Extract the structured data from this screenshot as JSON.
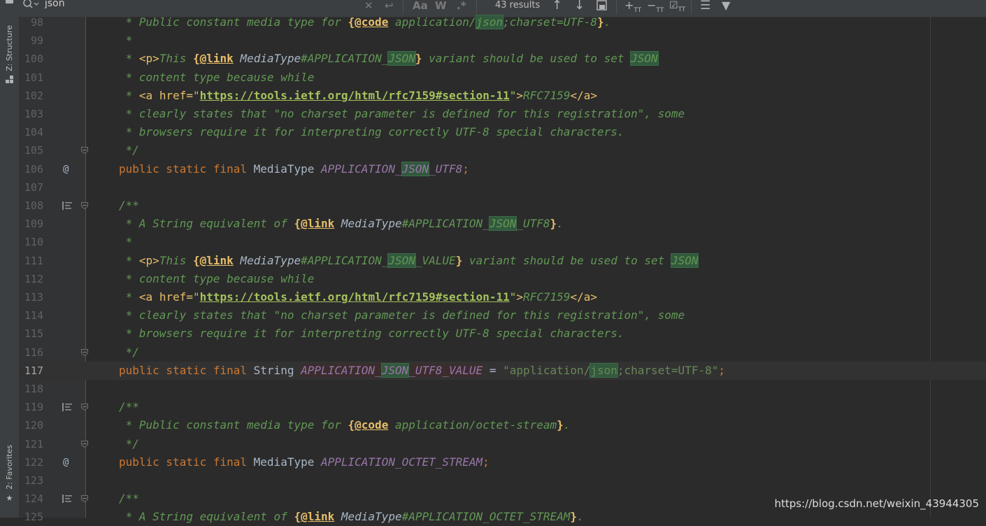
{
  "toolstrip": {
    "structure_label": "Z: Structure",
    "favorites_label": "2: Favorites"
  },
  "find": {
    "query": "json",
    "results": "43 results",
    "match_case_label": "Aa",
    "words_label": "W",
    "regex_label": ".*"
  },
  "editor": {
    "current_line": 117,
    "lines": [
      {
        "n": 98,
        "gutter": "",
        "fold": false
      },
      {
        "n": 99,
        "gutter": "",
        "fold": false
      },
      {
        "n": 100,
        "gutter": "",
        "fold": false
      },
      {
        "n": 101,
        "gutter": "",
        "fold": false
      },
      {
        "n": 102,
        "gutter": "",
        "fold": false
      },
      {
        "n": 103,
        "gutter": "",
        "fold": false
      },
      {
        "n": 104,
        "gutter": "",
        "fold": false
      },
      {
        "n": 105,
        "gutter": "",
        "fold": true
      },
      {
        "n": 106,
        "gutter": "@",
        "fold": false
      },
      {
        "n": 107,
        "gutter": "",
        "fold": false
      },
      {
        "n": 108,
        "gutter": "doc",
        "fold": true
      },
      {
        "n": 109,
        "gutter": "",
        "fold": false
      },
      {
        "n": 110,
        "gutter": "",
        "fold": false
      },
      {
        "n": 111,
        "gutter": "",
        "fold": false
      },
      {
        "n": 112,
        "gutter": "",
        "fold": false
      },
      {
        "n": 113,
        "gutter": "",
        "fold": false
      },
      {
        "n": 114,
        "gutter": "",
        "fold": false
      },
      {
        "n": 115,
        "gutter": "",
        "fold": false
      },
      {
        "n": 116,
        "gutter": "",
        "fold": true
      },
      {
        "n": 117,
        "gutter": "",
        "fold": false
      },
      {
        "n": 118,
        "gutter": "",
        "fold": false
      },
      {
        "n": 119,
        "gutter": "doc",
        "fold": true
      },
      {
        "n": 120,
        "gutter": "",
        "fold": false
      },
      {
        "n": 121,
        "gutter": "",
        "fold": true
      },
      {
        "n": 122,
        "gutter": "@",
        "fold": false
      },
      {
        "n": 123,
        "gutter": "",
        "fold": false
      },
      {
        "n": 124,
        "gutter": "doc",
        "fold": true
      },
      {
        "n": 125,
        "gutter": "",
        "fold": false
      }
    ]
  },
  "code": {
    "l98": [
      [
        "c",
        " * Public constant media type for "
      ],
      [
        "tg",
        "{"
      ],
      [
        "tg lk",
        "@code"
      ],
      [
        "c",
        " application/"
      ],
      [
        "c hl",
        "json"
      ],
      [
        "c",
        ";charset=UTF-8"
      ],
      [
        "tg",
        "}"
      ],
      [
        "c",
        "."
      ]
    ],
    "l99": [
      [
        "c",
        " *"
      ]
    ],
    "l100": [
      [
        "c",
        " * "
      ],
      [
        "ht",
        "<p>"
      ],
      [
        "c",
        "This "
      ],
      [
        "tg",
        "{"
      ],
      [
        "tg lk",
        "@link"
      ],
      [
        "rf",
        " MediaType"
      ],
      [
        "c",
        "#APPLICATION_"
      ],
      [
        "c hl",
        "JSON"
      ],
      [
        "tg",
        "}"
      ],
      [
        "c",
        " variant should be used to set "
      ],
      [
        "c hl",
        "JSON"
      ]
    ],
    "l101": [
      [
        "c",
        " * content type because while"
      ]
    ],
    "l102": [
      [
        "c",
        " * "
      ],
      [
        "ht",
        "<a "
      ],
      [
        "ht",
        "href="
      ],
      [
        "hv",
        "\""
      ],
      [
        "hv lk",
        "https://tools.ietf.org/html/rfc7159#section-11"
      ],
      [
        "hv",
        "\""
      ],
      [
        "ht",
        ">"
      ],
      [
        "c",
        "RFC7159"
      ],
      [
        "ht",
        "</a>"
      ]
    ],
    "l103": [
      [
        "c",
        " * clearly states that \"no charset parameter is defined for this registration\", some"
      ]
    ],
    "l104": [
      [
        "c",
        " * browsers require it for interpreting correctly UTF-8 special characters."
      ]
    ],
    "l105": [
      [
        "c",
        " */"
      ]
    ],
    "l106": [
      [
        "kw",
        "public static final "
      ],
      [
        "ty",
        "MediaType "
      ],
      [
        "fd",
        "APPLICATION_"
      ],
      [
        "fd hl",
        "JSON"
      ],
      [
        "fd",
        "_UTF8"
      ],
      [
        "kw",
        ";"
      ]
    ],
    "l107": [],
    "l108": [
      [
        "c",
        "/**"
      ]
    ],
    "l109": [
      [
        "c",
        " * A String equivalent of "
      ],
      [
        "tg",
        "{"
      ],
      [
        "tg lk",
        "@link"
      ],
      [
        "rf",
        " MediaType"
      ],
      [
        "c",
        "#APPLICATION_"
      ],
      [
        "c hl",
        "JSON"
      ],
      [
        "c",
        "_UTF8"
      ],
      [
        "tg",
        "}"
      ],
      [
        "c",
        "."
      ]
    ],
    "l110": [
      [
        "c",
        " *"
      ]
    ],
    "l111": [
      [
        "c",
        " * "
      ],
      [
        "ht",
        "<p>"
      ],
      [
        "c",
        "This "
      ],
      [
        "tg",
        "{"
      ],
      [
        "tg lk",
        "@link"
      ],
      [
        "rf",
        " MediaType"
      ],
      [
        "c",
        "#APPLICATION_"
      ],
      [
        "c hl",
        "JSON"
      ],
      [
        "c",
        "_VALUE"
      ],
      [
        "tg",
        "}"
      ],
      [
        "c",
        " variant should be used to set "
      ],
      [
        "c hl",
        "JSON"
      ]
    ],
    "l112": [
      [
        "c",
        " * content type because while"
      ]
    ],
    "l113": [
      [
        "c",
        " * "
      ],
      [
        "ht",
        "<a "
      ],
      [
        "ht",
        "href="
      ],
      [
        "hv",
        "\""
      ],
      [
        "hv lk",
        "https://tools.ietf.org/html/rfc7159#section-11"
      ],
      [
        "hv",
        "\""
      ],
      [
        "ht",
        ">"
      ],
      [
        "c",
        "RFC7159"
      ],
      [
        "ht",
        "</a>"
      ]
    ],
    "l114": [
      [
        "c",
        " * clearly states that \"no charset parameter is defined for this registration\", some"
      ]
    ],
    "l115": [
      [
        "c",
        " * browsers require it for interpreting correctly UTF-8 special characters."
      ]
    ],
    "l116": [
      [
        "c",
        " */"
      ]
    ],
    "l117": [
      [
        "kw",
        "public static final "
      ],
      [
        "ty",
        "String "
      ],
      [
        "fd fdcur",
        "APPLICATION_"
      ],
      [
        "fd hl",
        "JSON"
      ],
      [
        "fd fdcur",
        "_UTF8_VALUE"
      ],
      [
        "ty",
        " = "
      ],
      [
        "st",
        "\"application/"
      ],
      [
        "st hl",
        "json"
      ],
      [
        "st",
        ";charset=UTF-8\""
      ],
      [
        "kw",
        ";"
      ]
    ],
    "l118": [],
    "l119": [
      [
        "c",
        "/**"
      ]
    ],
    "l120": [
      [
        "c",
        " * Public constant media type for "
      ],
      [
        "tg",
        "{"
      ],
      [
        "tg lk",
        "@code"
      ],
      [
        "c",
        " application/octet-stream"
      ],
      [
        "tg",
        "}"
      ],
      [
        "c",
        "."
      ]
    ],
    "l121": [
      [
        "c",
        " */"
      ]
    ],
    "l122": [
      [
        "kw",
        "public static final "
      ],
      [
        "ty",
        "MediaType "
      ],
      [
        "fd",
        "APPLICATION_OCTET_STREAM"
      ],
      [
        "kw",
        ";"
      ]
    ],
    "l123": [],
    "l124": [
      [
        "c",
        "/**"
      ]
    ],
    "l125": [
      [
        "c",
        " * A String equivalent of "
      ],
      [
        "tg",
        "{"
      ],
      [
        "tg lk",
        "@link"
      ],
      [
        "rf",
        " MediaType"
      ],
      [
        "c",
        "#APPLICATION_OCTET_STREAM"
      ],
      [
        "tg",
        "}"
      ],
      [
        "c",
        "."
      ]
    ]
  },
  "watermark": "https://blog.csdn.net/weixin_43944305"
}
